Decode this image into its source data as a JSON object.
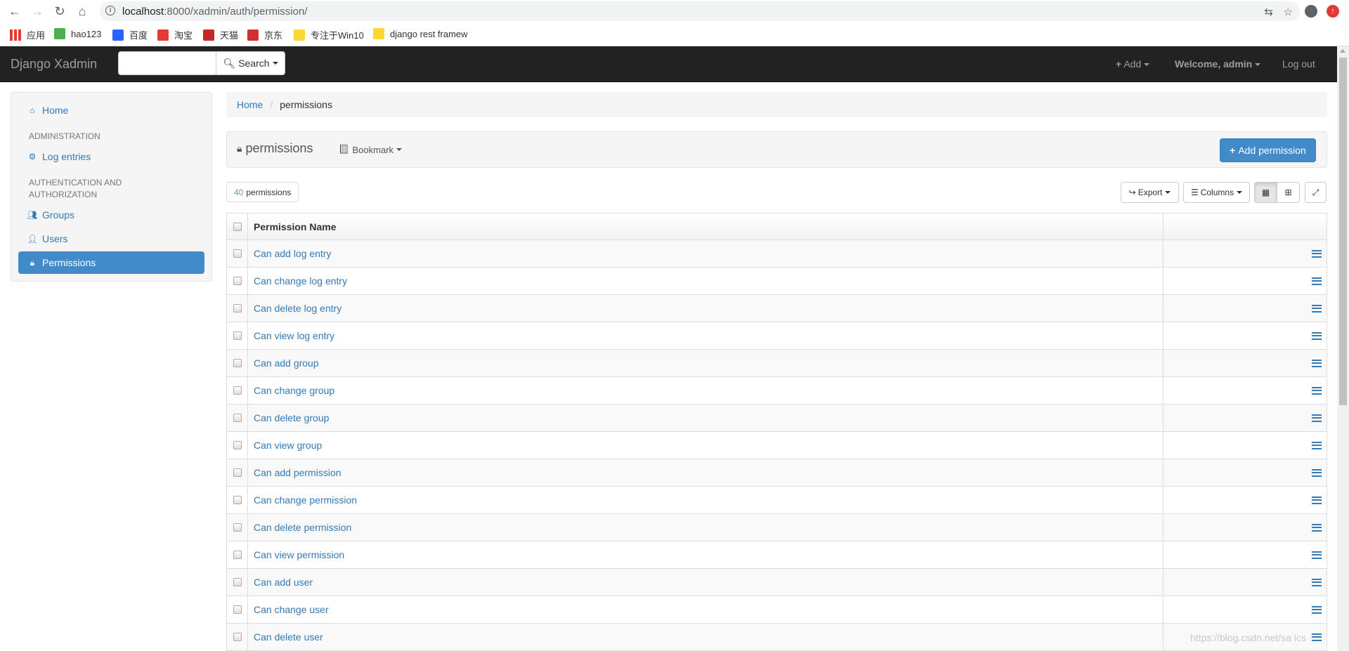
{
  "browser": {
    "url_host": "localhost",
    "url_path": ":8000/xadmin/auth/permission/",
    "bookmarks": [
      {
        "label": "应用",
        "color": "#e53935"
      },
      {
        "label": "hao123",
        "color": "#4caf50"
      },
      {
        "label": "百度",
        "color": "#2962ff"
      },
      {
        "label": "淘宝",
        "color": "#e53935"
      },
      {
        "label": "天猫",
        "color": "#c62828"
      },
      {
        "label": "京东",
        "color": "#d32f2f"
      },
      {
        "label": "专注于Win10",
        "color": "#fdd835"
      },
      {
        "label": "django rest framew",
        "color": "#fdd835"
      }
    ]
  },
  "navbar": {
    "brand": "Django Xadmin",
    "search_label": "Search",
    "add_label": "Add",
    "welcome_label": "Welcome, admin",
    "logout_label": "Log out"
  },
  "sidebar": {
    "home": "Home",
    "section_admin": "ADMINISTRATION",
    "log_entries": "Log entries",
    "section_auth_line1": "AUTHENTICATION AND",
    "section_auth_line2": "AUTHORIZATION",
    "groups": "Groups",
    "users": "Users",
    "permissions": "Permissions"
  },
  "breadcrumb": {
    "home": "Home",
    "current": "permissions"
  },
  "page": {
    "title": "permissions",
    "bookmark_label": "Bookmark",
    "add_button": "Add permission"
  },
  "toolbar": {
    "count_num": "40",
    "count_label": "permissions",
    "export_label": "Export",
    "columns_label": "Columns"
  },
  "table": {
    "header_name": "Permission Name",
    "rows": [
      "Can add log entry",
      "Can change log entry",
      "Can delete log entry",
      "Can view log entry",
      "Can add group",
      "Can change group",
      "Can delete group",
      "Can view group",
      "Can add permission",
      "Can change permission",
      "Can delete permission",
      "Can view permission",
      "Can add user",
      "Can change user",
      "Can delete user"
    ]
  },
  "watermark": "https://blog.csdn.net/sa   ics"
}
